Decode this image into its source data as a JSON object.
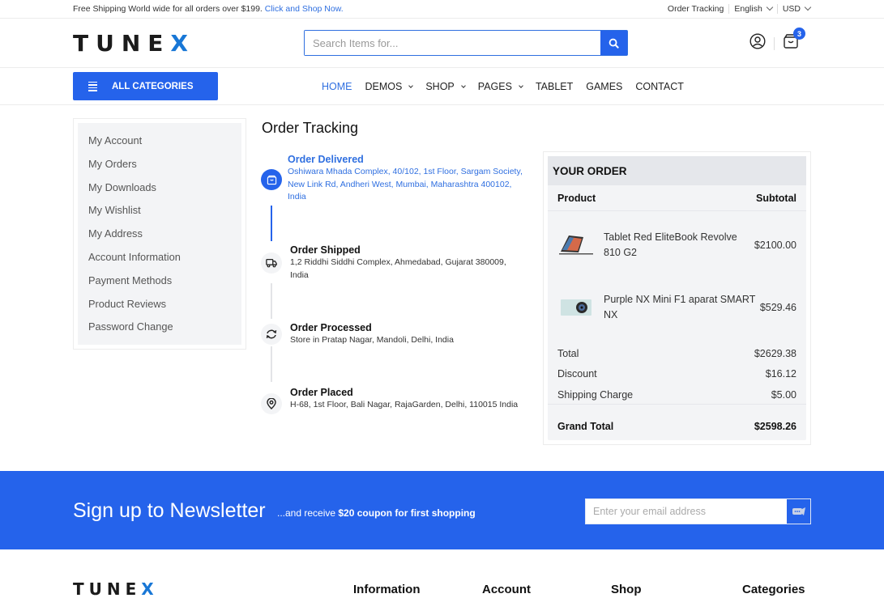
{
  "topbar": {
    "promo_text": "Free Shipping World wide for all orders over $199.",
    "promo_link": "Click and Shop Now.",
    "order_tracking": "Order Tracking",
    "language": "English",
    "currency": "USD"
  },
  "header": {
    "logo_main": "TUNE",
    "logo_accent": "X",
    "search_placeholder": "Search Items for...",
    "cart_count": "3"
  },
  "nav": {
    "all_categories": "ALL CATEGORIES",
    "items": [
      {
        "label": "HOME",
        "active": true,
        "dropdown": false
      },
      {
        "label": "DEMOS",
        "active": false,
        "dropdown": true
      },
      {
        "label": "SHOP",
        "active": false,
        "dropdown": true
      },
      {
        "label": "PAGES",
        "active": false,
        "dropdown": true
      },
      {
        "label": "TABLET",
        "active": false,
        "dropdown": false
      },
      {
        "label": "GAMES",
        "active": false,
        "dropdown": false
      },
      {
        "label": "CONTACT",
        "active": false,
        "dropdown": false
      }
    ]
  },
  "sidebar": {
    "items": [
      {
        "label": "My Account"
      },
      {
        "label": "My Orders"
      },
      {
        "label": "My Downloads"
      },
      {
        "label": "My Wishlist"
      },
      {
        "label": "My Address"
      },
      {
        "label": "Account Information"
      },
      {
        "label": "Payment Methods"
      },
      {
        "label": "Product Reviews"
      },
      {
        "label": "Password Change"
      }
    ]
  },
  "tracking": {
    "title": "Order Tracking",
    "steps": [
      {
        "status": "Order Delivered",
        "address": "Oshiwara Mhada Complex, 40/102, 1st Floor, Sargam Society, New Link Rd, Andheri West, Mumbai, Maharashtra 400102, India",
        "icon": "bag-icon",
        "current": true
      },
      {
        "status": "Order Shipped",
        "address": "1,2 Riddhi Siddhi Complex, Ahmedabad, Gujarat 380009, India",
        "icon": "truck-icon",
        "current": false
      },
      {
        "status": "Order Processed",
        "address": "Store in Pratap Nagar, Mandoli, Delhi, India",
        "icon": "refresh-icon",
        "current": false
      },
      {
        "status": "Order Placed",
        "address": "H-68, 1st Floor, Bali Nagar, RajaGarden, Delhi, 110015 India",
        "icon": "location-pin-icon",
        "current": false
      }
    ]
  },
  "order": {
    "heading": "YOUR ORDER",
    "col_product": "Product",
    "col_subtotal": "Subtotal",
    "items": [
      {
        "name": "Tablet Red EliteBook Revolve 810 G2",
        "price": "$2100.00"
      },
      {
        "name": "Purple NX Mini F1 aparat SMART NX",
        "price": "$529.46"
      }
    ],
    "summary": [
      {
        "label": "Total",
        "value": "$2629.38"
      },
      {
        "label": "Discount",
        "value": "$16.12"
      },
      {
        "label": "Shipping Charge",
        "value": "$5.00"
      }
    ],
    "grand_total_label": "Grand Total",
    "grand_total_value": "$2598.26"
  },
  "newsletter": {
    "title": "Sign up to Newsletter",
    "sub_prefix": "...and receive ",
    "sub_bold": "$20 coupon for first shopping",
    "email_placeholder": "Enter your email address"
  },
  "footer": {
    "logo_main": "TUNE",
    "logo_accent": "X",
    "columns": [
      "Information",
      "Account",
      "Shop",
      "Categories"
    ]
  },
  "colors": {
    "accent": "#2563eb",
    "link": "#2f6fe0",
    "logo_accent": "#1877d6",
    "panel_bg": "#f3f4f6"
  }
}
